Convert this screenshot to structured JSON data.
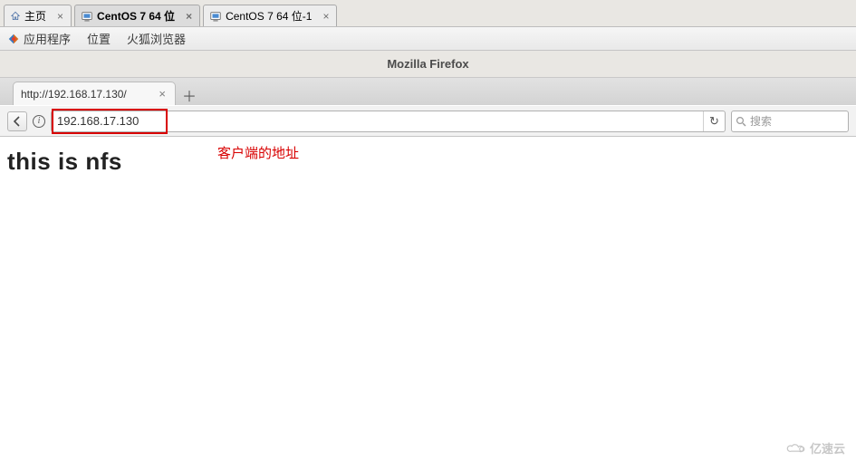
{
  "vmware_tabs": [
    {
      "label": "主页",
      "kind": "home",
      "active": false
    },
    {
      "label": "CentOS 7 64 位",
      "kind": "os",
      "active": true
    },
    {
      "label": "CentOS 7 64 位-1",
      "kind": "os",
      "active": false
    }
  ],
  "gnome": {
    "apps": "应用程序",
    "places": "位置",
    "firefox": "火狐浏览器"
  },
  "firefox": {
    "window_title": "Mozilla Firefox",
    "tab_title": "http://192.168.17.130/",
    "url_value": "192.168.17.130",
    "search_placeholder": "搜索"
  },
  "annotation": "客户端的地址",
  "page_body": "this is nfs",
  "watermark": "亿速云"
}
